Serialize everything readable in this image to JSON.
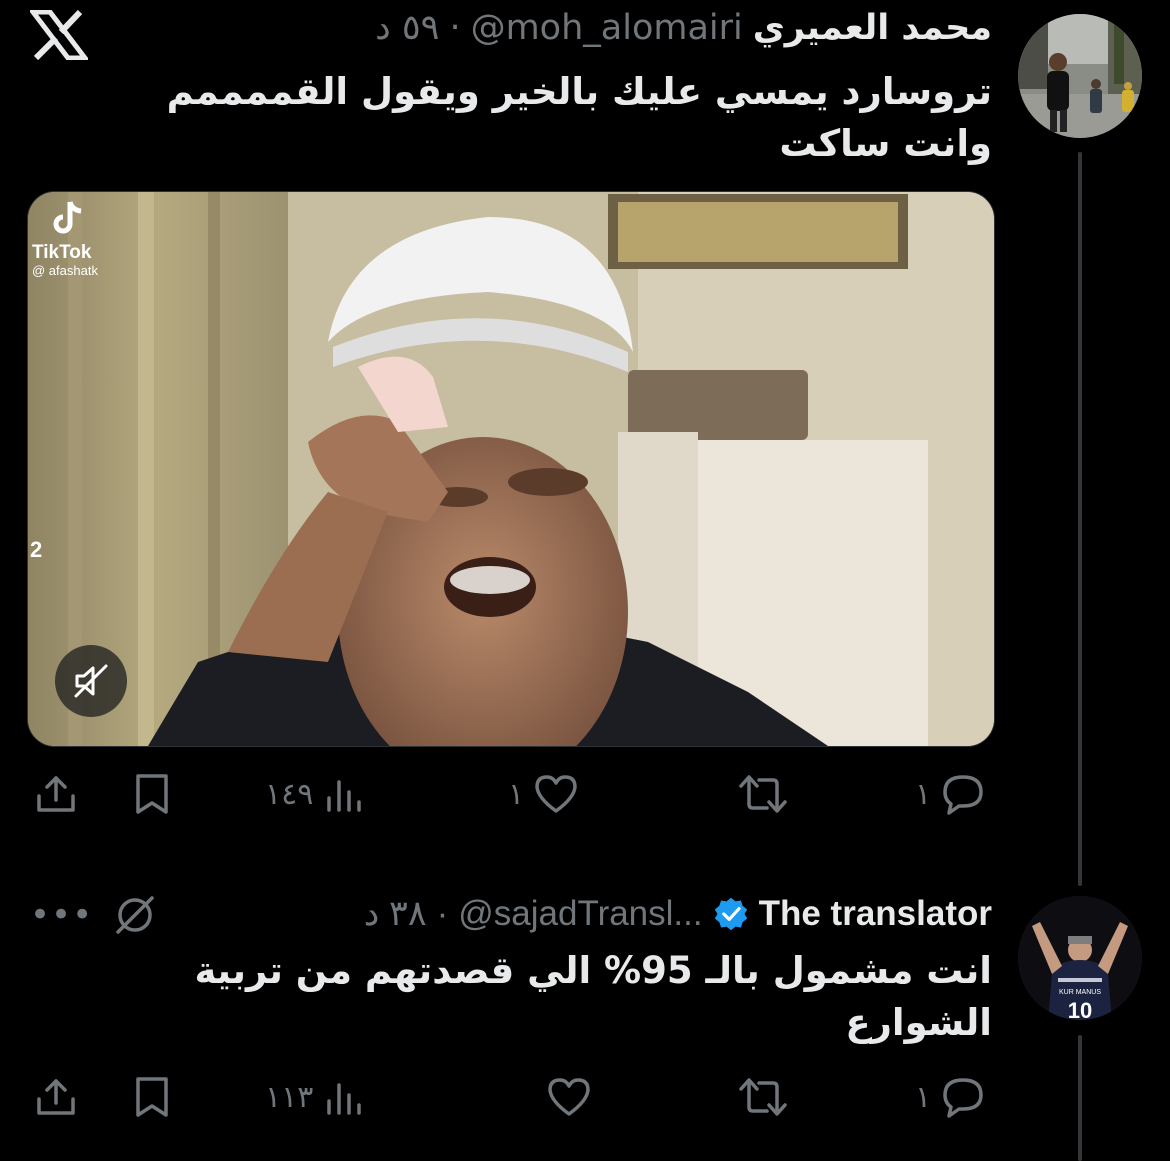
{
  "tweet1": {
    "display_name": "محمد العميري",
    "handle": "@moh_alomairi",
    "time_ago": "٥٩ د",
    "text": "تروسارد يمسي عليك بالخير ويقول القممممم وانت ساكت",
    "media": {
      "watermark_brand": "TikTok",
      "watermark_user": "@ afashatk",
      "side_number": "2"
    },
    "actions": {
      "replies": "١",
      "retweets": "",
      "likes": "١",
      "views": "١٤٩"
    }
  },
  "tweet2": {
    "display_name": "The translator",
    "handle": "@sajadTransl...",
    "time_ago": "٣٨ د",
    "text": "انت مشمول بالـ 95% الي قصدتهم من تربية الشوارع",
    "avatar_jersey_number": "10",
    "avatar_jersey_name": "KUR MANUS",
    "actions": {
      "replies": "١",
      "retweets": "",
      "likes": "",
      "views": "١١٣"
    }
  },
  "more_label": "•••",
  "dot_separator": "·",
  "colors": {
    "background": "#000000",
    "text_primary": "#e7e9ea",
    "text_secondary": "#71767b",
    "verified": "#1d9bf0",
    "thread_line": "#333639"
  },
  "icons": {
    "app": "x-logo-icon",
    "verified": "verified-badge-icon",
    "reply": "reply-icon",
    "retweet": "retweet-icon",
    "like": "heart-icon",
    "views": "views-icon",
    "bookmark": "bookmark-icon",
    "share": "share-icon",
    "mute": "muted-speaker-icon",
    "grok": "grok-icon",
    "more": "more-icon"
  }
}
